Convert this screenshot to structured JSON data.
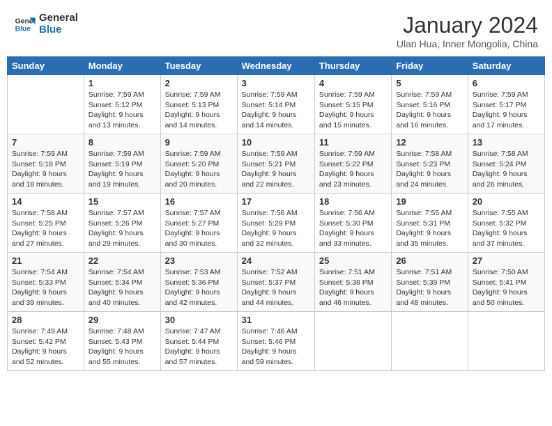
{
  "logo": {
    "text_general": "General",
    "text_blue": "Blue"
  },
  "header": {
    "month_title": "January 2024",
    "subtitle": "Ulan Hua, Inner Mongolia, China"
  },
  "days_of_week": [
    "Sunday",
    "Monday",
    "Tuesday",
    "Wednesday",
    "Thursday",
    "Friday",
    "Saturday"
  ],
  "weeks": [
    [
      {
        "day": "",
        "content": ""
      },
      {
        "day": "1",
        "content": "Sunrise: 7:59 AM\nSunset: 5:12 PM\nDaylight: 9 hours\nand 13 minutes."
      },
      {
        "day": "2",
        "content": "Sunrise: 7:59 AM\nSunset: 5:13 PM\nDaylight: 9 hours\nand 14 minutes."
      },
      {
        "day": "3",
        "content": "Sunrise: 7:59 AM\nSunset: 5:14 PM\nDaylight: 9 hours\nand 14 minutes."
      },
      {
        "day": "4",
        "content": "Sunrise: 7:59 AM\nSunset: 5:15 PM\nDaylight: 9 hours\nand 15 minutes."
      },
      {
        "day": "5",
        "content": "Sunrise: 7:59 AM\nSunset: 5:16 PM\nDaylight: 9 hours\nand 16 minutes."
      },
      {
        "day": "6",
        "content": "Sunrise: 7:59 AM\nSunset: 5:17 PM\nDaylight: 9 hours\nand 17 minutes."
      }
    ],
    [
      {
        "day": "7",
        "content": "Sunrise: 7:59 AM\nSunset: 5:18 PM\nDaylight: 9 hours\nand 18 minutes."
      },
      {
        "day": "8",
        "content": "Sunrise: 7:59 AM\nSunset: 5:19 PM\nDaylight: 9 hours\nand 19 minutes."
      },
      {
        "day": "9",
        "content": "Sunrise: 7:59 AM\nSunset: 5:20 PM\nDaylight: 9 hours\nand 20 minutes."
      },
      {
        "day": "10",
        "content": "Sunrise: 7:59 AM\nSunset: 5:21 PM\nDaylight: 9 hours\nand 22 minutes."
      },
      {
        "day": "11",
        "content": "Sunrise: 7:59 AM\nSunset: 5:22 PM\nDaylight: 9 hours\nand 23 minutes."
      },
      {
        "day": "12",
        "content": "Sunrise: 7:58 AM\nSunset: 5:23 PM\nDaylight: 9 hours\nand 24 minutes."
      },
      {
        "day": "13",
        "content": "Sunrise: 7:58 AM\nSunset: 5:24 PM\nDaylight: 9 hours\nand 26 minutes."
      }
    ],
    [
      {
        "day": "14",
        "content": "Sunrise: 7:58 AM\nSunset: 5:25 PM\nDaylight: 9 hours\nand 27 minutes."
      },
      {
        "day": "15",
        "content": "Sunrise: 7:57 AM\nSunset: 5:26 PM\nDaylight: 9 hours\nand 29 minutes."
      },
      {
        "day": "16",
        "content": "Sunrise: 7:57 AM\nSunset: 5:27 PM\nDaylight: 9 hours\nand 30 minutes."
      },
      {
        "day": "17",
        "content": "Sunrise: 7:56 AM\nSunset: 5:29 PM\nDaylight: 9 hours\nand 32 minutes."
      },
      {
        "day": "18",
        "content": "Sunrise: 7:56 AM\nSunset: 5:30 PM\nDaylight: 9 hours\nand 33 minutes."
      },
      {
        "day": "19",
        "content": "Sunrise: 7:55 AM\nSunset: 5:31 PM\nDaylight: 9 hours\nand 35 minutes."
      },
      {
        "day": "20",
        "content": "Sunrise: 7:55 AM\nSunset: 5:32 PM\nDaylight: 9 hours\nand 37 minutes."
      }
    ],
    [
      {
        "day": "21",
        "content": "Sunrise: 7:54 AM\nSunset: 5:33 PM\nDaylight: 9 hours\nand 39 minutes."
      },
      {
        "day": "22",
        "content": "Sunrise: 7:54 AM\nSunset: 5:34 PM\nDaylight: 9 hours\nand 40 minutes."
      },
      {
        "day": "23",
        "content": "Sunrise: 7:53 AM\nSunset: 5:36 PM\nDaylight: 9 hours\nand 42 minutes."
      },
      {
        "day": "24",
        "content": "Sunrise: 7:52 AM\nSunset: 5:37 PM\nDaylight: 9 hours\nand 44 minutes."
      },
      {
        "day": "25",
        "content": "Sunrise: 7:51 AM\nSunset: 5:38 PM\nDaylight: 9 hours\nand 46 minutes."
      },
      {
        "day": "26",
        "content": "Sunrise: 7:51 AM\nSunset: 5:39 PM\nDaylight: 9 hours\nand 48 minutes."
      },
      {
        "day": "27",
        "content": "Sunrise: 7:50 AM\nSunset: 5:41 PM\nDaylight: 9 hours\nand 50 minutes."
      }
    ],
    [
      {
        "day": "28",
        "content": "Sunrise: 7:49 AM\nSunset: 5:42 PM\nDaylight: 9 hours\nand 52 minutes."
      },
      {
        "day": "29",
        "content": "Sunrise: 7:48 AM\nSunset: 5:43 PM\nDaylight: 9 hours\nand 55 minutes."
      },
      {
        "day": "30",
        "content": "Sunrise: 7:47 AM\nSunset: 5:44 PM\nDaylight: 9 hours\nand 57 minutes."
      },
      {
        "day": "31",
        "content": "Sunrise: 7:46 AM\nSunset: 5:46 PM\nDaylight: 9 hours\nand 59 minutes."
      },
      {
        "day": "",
        "content": ""
      },
      {
        "day": "",
        "content": ""
      },
      {
        "day": "",
        "content": ""
      }
    ]
  ]
}
